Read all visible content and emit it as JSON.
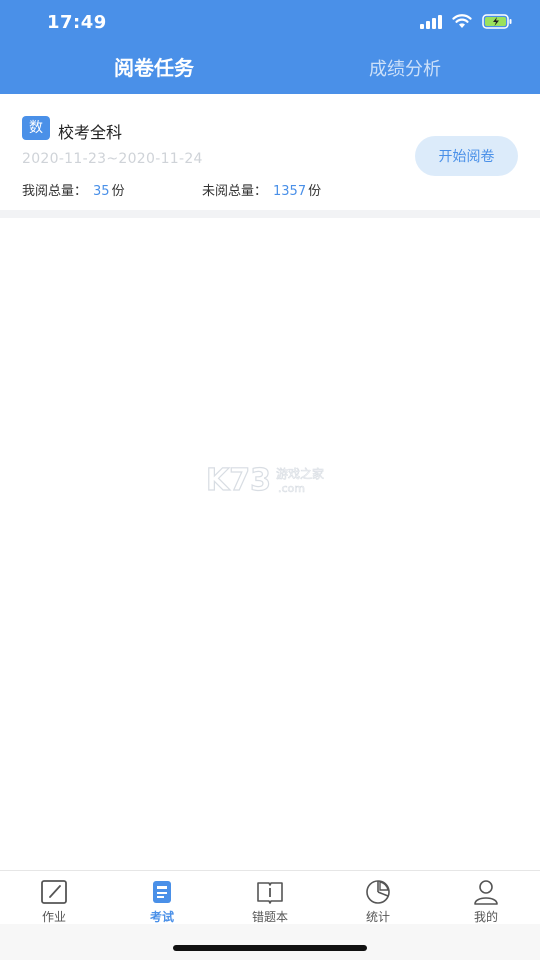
{
  "status_bar": {
    "time": "17:49"
  },
  "header": {
    "tabs": [
      {
        "label": "阅卷任务",
        "active": true
      },
      {
        "label": "成绩分析",
        "active": false
      }
    ]
  },
  "task": {
    "subject_badge": "数",
    "title": "校考全科",
    "date_range": "2020-11-23~2020-11-24",
    "my_read_label": "我阅总量：",
    "my_read_count": "35",
    "unread_label": "未阅总量：",
    "unread_count": "1357",
    "unit": "份",
    "start_button": "开始阅卷"
  },
  "watermark": {
    "text_main": "K73",
    "text_cn": "游戏之家",
    "text_domain": ".com"
  },
  "tabbar": {
    "items": [
      {
        "label": "作业",
        "icon": "homework-icon"
      },
      {
        "label": "考试",
        "icon": "exam-icon",
        "active": true
      },
      {
        "label": "错题本",
        "icon": "mistake-book-icon"
      },
      {
        "label": "统计",
        "icon": "statistics-icon"
      },
      {
        "label": "我的",
        "icon": "profile-icon"
      }
    ]
  },
  "colors": {
    "primary": "#4a90e8",
    "button_bg": "#dcebfa",
    "date_gray": "#cfd3d8"
  }
}
